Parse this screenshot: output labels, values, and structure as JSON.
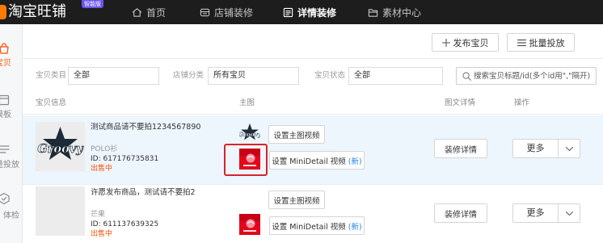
{
  "topbar": {
    "logo_text": "淘宝旺铺",
    "badge": "智能版",
    "nav": [
      {
        "label": "首页",
        "icon": "home-icon",
        "active": false
      },
      {
        "label": "店铺装修",
        "icon": "store-icon",
        "active": false
      },
      {
        "label": "详情装修",
        "icon": "detail-icon",
        "active": true
      },
      {
        "label": "素材中心",
        "icon": "folder-icon",
        "active": false
      }
    ]
  },
  "sidebar": {
    "items": [
      {
        "label": "宝贝",
        "icon": "product-bag-icon",
        "active": true
      },
      {
        "label": "模板",
        "icon": "template-icon",
        "active": false
      },
      {
        "label": "量投放",
        "icon": "batch-list-icon",
        "active": false
      },
      {
        "label": "体检",
        "icon": "shield-check-icon",
        "active": false
      }
    ]
  },
  "toolbar": {
    "publish": {
      "label": "发布宝贝",
      "icon": "plus-icon"
    },
    "batch": {
      "label": "批量投放",
      "icon": "list-icon"
    }
  },
  "filters": {
    "category": {
      "label": "宝贝类目",
      "value": "全部"
    },
    "shop_category": {
      "label": "店铺分类",
      "value": "所有宝贝"
    },
    "status": {
      "label": "宝贝状态",
      "value": "全部"
    },
    "search": {
      "icon": "search-icon",
      "placeholder": "搜索宝贝标题/id(多个id用\",\"隔开)"
    }
  },
  "table": {
    "headers": {
      "info": "宝贝信息",
      "main_image": "主图",
      "detail": "图文详情",
      "actions": "操作"
    },
    "rows": [
      {
        "title": "测试商品请不要拍1234567890",
        "category": "POLO衫",
        "id": "ID: 617176735831",
        "status": "出售中",
        "image_logo_text": "Groovy",
        "main_video_label": "设置主图视频",
        "minidetail_label": "设置 MiniDetail 视频",
        "minidetail_tag": "(新)",
        "detail_label": "装修详情",
        "more_label": "更多"
      },
      {
        "title": "许愿发布商品，测试请不要拍2",
        "category": "芒果",
        "id": "ID: 611137639325",
        "status": "出售中",
        "main_video_label": "设置主图视频",
        "minidetail_label": "设置 MiniDetail 视频",
        "minidetail_tag": "(新)",
        "detail_label": "装修详情",
        "more_label": "更多"
      }
    ]
  },
  "colors": {
    "accent": "#ff5000",
    "topbar": "#1d1d1d",
    "link_blue": "#2b87e3",
    "annotation_box": "#d9242b",
    "row_hover": "#edf5fd",
    "badge": "#6a55ee"
  }
}
